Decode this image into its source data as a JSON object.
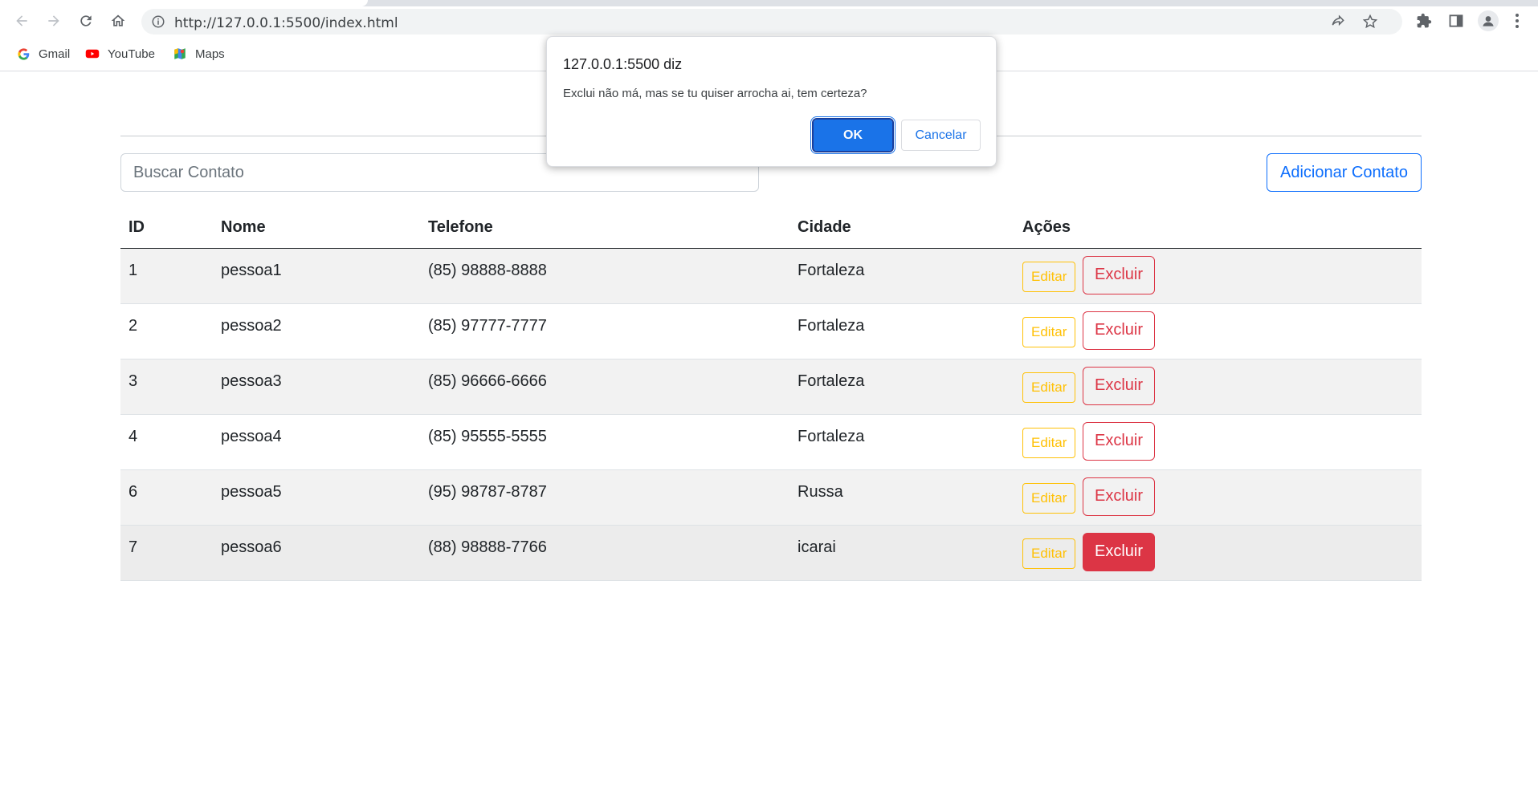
{
  "browser": {
    "url": "http://127.0.0.1:5500/index.html",
    "bookmarks": [
      "Gmail",
      "YouTube",
      "Maps"
    ]
  },
  "page": {
    "search_placeholder": "Buscar Contato",
    "add_button": "Adicionar Contato",
    "table": {
      "headers": [
        "ID",
        "Nome",
        "Telefone",
        "Cidade",
        "Ações"
      ],
      "rows": [
        {
          "id": "1",
          "nome": "pessoa1",
          "telefone": "(85) 98888-8888",
          "cidade": "Fortaleza"
        },
        {
          "id": "2",
          "nome": "pessoa2",
          "telefone": "(85) 97777-7777",
          "cidade": "Fortaleza"
        },
        {
          "id": "3",
          "nome": "pessoa3",
          "telefone": "(85) 96666-6666",
          "cidade": "Fortaleza"
        },
        {
          "id": "4",
          "nome": "pessoa4",
          "telefone": "(85) 95555-5555",
          "cidade": "Fortaleza"
        },
        {
          "id": "6",
          "nome": "pessoa5",
          "telefone": "(95) 98787-8787",
          "cidade": "Russa"
        },
        {
          "id": "7",
          "nome": "pessoa6",
          "telefone": "(88) 98888-7766",
          "cidade": "icarai"
        }
      ],
      "edit_label": "Editar",
      "delete_label": "Excluir"
    }
  },
  "dialog": {
    "title": "127.0.0.1:5500 diz",
    "message": "Exclui não má, mas se tu quiser arrocha ai, tem certeza?",
    "ok": "OK",
    "cancel": "Cancelar"
  },
  "colors": {
    "primary": "#0d6efd",
    "warning": "#ffc107",
    "danger": "#dc3545",
    "dialog_ok": "#1a73e8"
  }
}
